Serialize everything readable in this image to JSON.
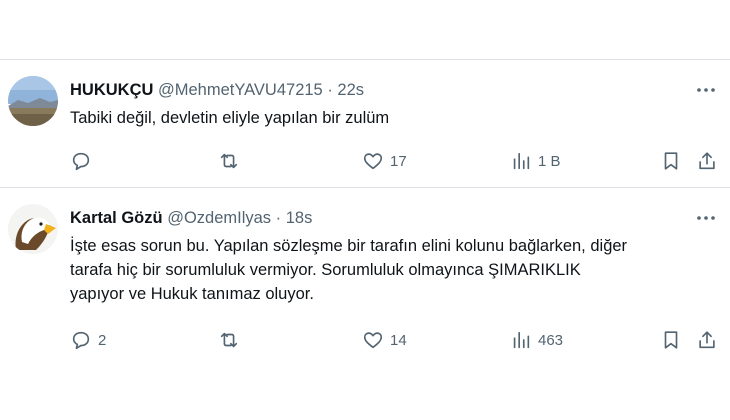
{
  "tweets": [
    {
      "display_name": "HUKUKÇU",
      "handle": "@MehmetYAVU47215",
      "separator": "·",
      "time": "22s",
      "text": "Tabiki değil, devletin eliyle yapılan bir zulüm",
      "reply_count": "",
      "repost_count": "",
      "like_count": "17",
      "view_count": "1 B",
      "avatar_icon": "landscape-avatar"
    },
    {
      "display_name": "Kartal Gözü",
      "handle": "@OzdemIlyas",
      "separator": "·",
      "time": "18s",
      "text_lines": [
        "İşte esas sorun bu. Yapılan sözleşme bir tarafın elini kolunu bağlarken, diğer",
        "tarafa hiç bir sorumluluk vermiyor. Sorumluluk olmayınca ŞIMARIKLIK",
        "yapıyor ve Hukuk tanımaz oluyor."
      ],
      "reply_count": "2",
      "repost_count": "",
      "like_count": "14",
      "view_count": "463",
      "avatar_icon": "eagle-avatar"
    }
  ],
  "colors": {
    "text": "#0f1419",
    "secondary": "#536471",
    "divider": "#dfe3e7",
    "background": "#ffffff"
  }
}
